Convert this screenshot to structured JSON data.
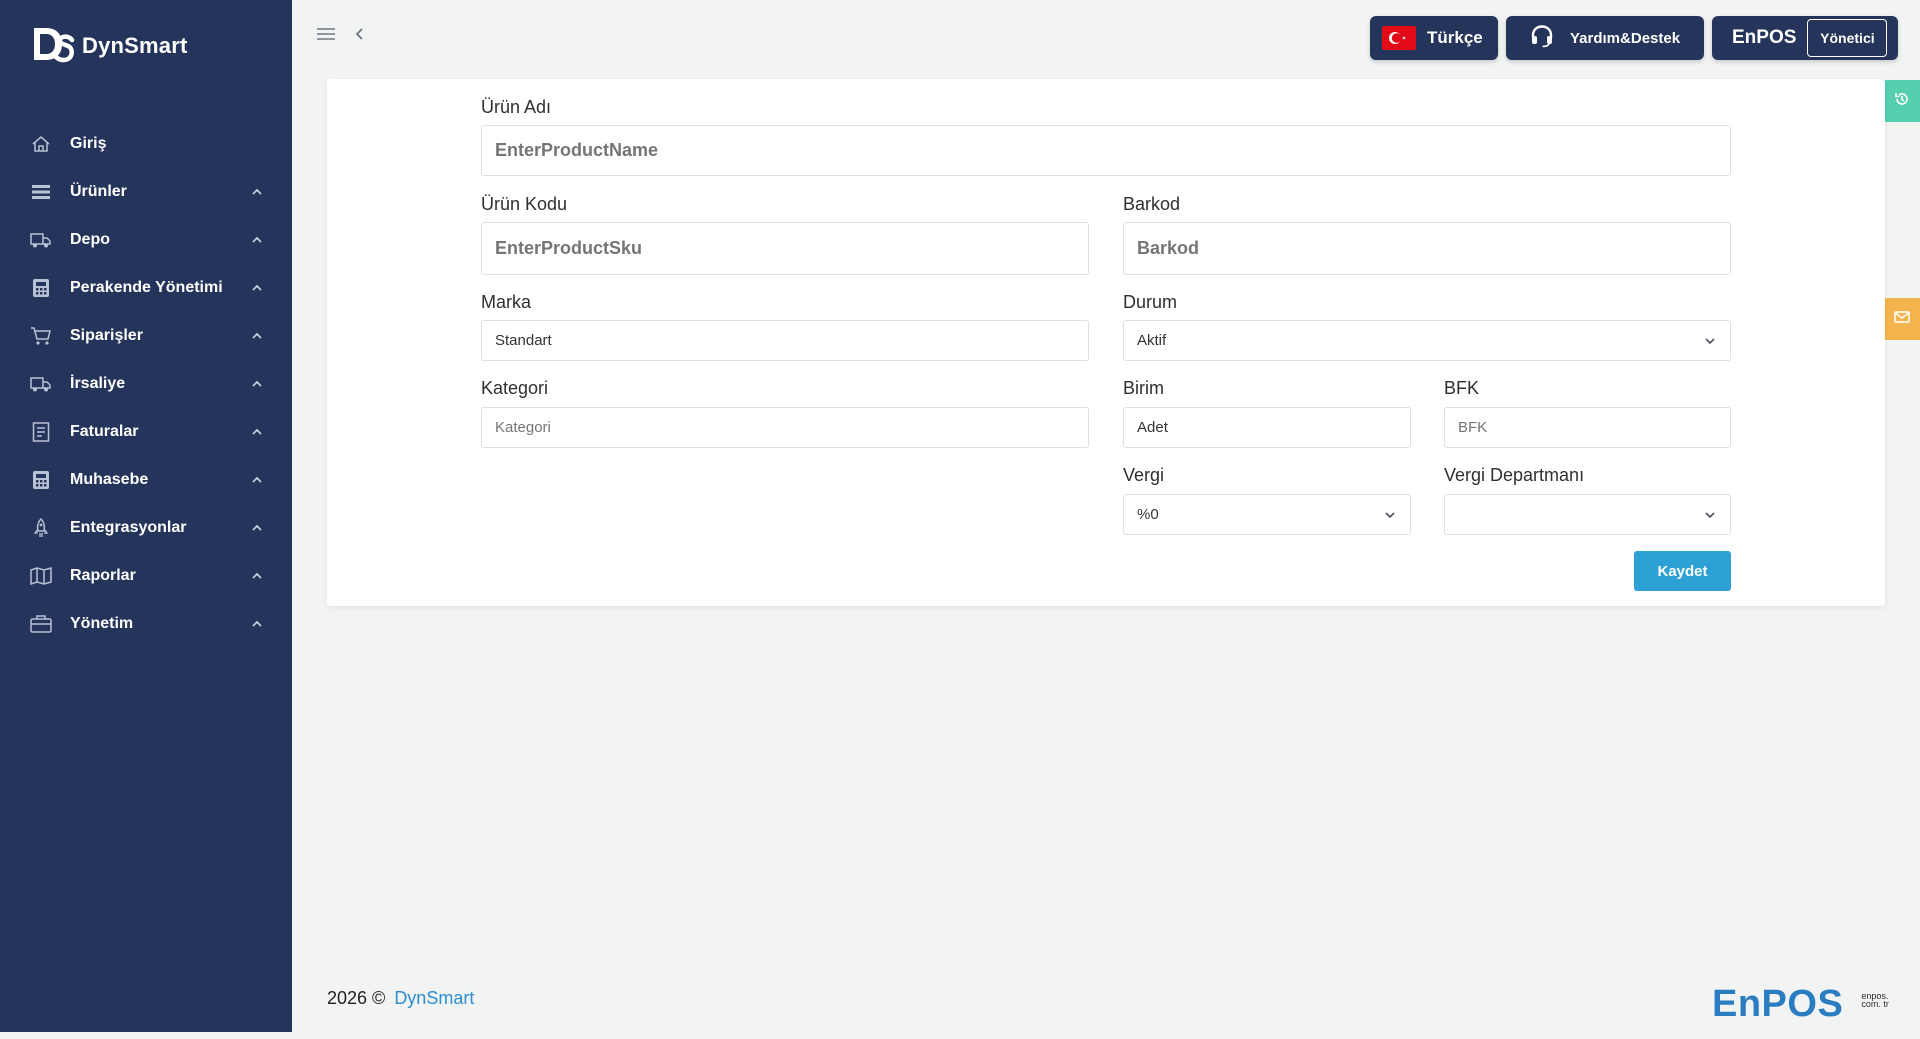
{
  "app": {
    "name": "DynSmart"
  },
  "sidebar": {
    "items": [
      {
        "label": "Giriş",
        "icon": "home-icon",
        "expandable": false
      },
      {
        "label": "Ürünler",
        "icon": "list-icon",
        "expandable": true
      },
      {
        "label": "Depo",
        "icon": "truck-icon",
        "expandable": true
      },
      {
        "label": "Perakende Yönetimi",
        "icon": "calculator-icon",
        "expandable": true
      },
      {
        "label": "Siparişler",
        "icon": "cart-icon",
        "expandable": true
      },
      {
        "label": "İrsaliye",
        "icon": "truck-icon",
        "expandable": true
      },
      {
        "label": "Faturalar",
        "icon": "invoice-icon",
        "expandable": true
      },
      {
        "label": "Muhasebe",
        "icon": "calculator-icon",
        "expandable": true
      },
      {
        "label": "Entegrasyonlar",
        "icon": "rocket-icon",
        "expandable": true
      },
      {
        "label": "Raporlar",
        "icon": "map-icon",
        "expandable": true
      },
      {
        "label": "Yönetim",
        "icon": "briefcase-icon",
        "expandable": true
      }
    ]
  },
  "header": {
    "language": "Türkçe",
    "help": "Yardım&Destek",
    "brand": "EnPOS",
    "role": "Yönetici"
  },
  "form": {
    "product_name": {
      "label": "Ürün Adı",
      "placeholder": "EnterProductName",
      "value": ""
    },
    "product_code": {
      "label": "Ürün Kodu",
      "placeholder": "EnterProductSku",
      "value": ""
    },
    "barcode": {
      "label": "Barkod",
      "placeholder": "Barkod",
      "value": ""
    },
    "brand": {
      "label": "Marka",
      "value": "Standart"
    },
    "status": {
      "label": "Durum",
      "value": "Aktif"
    },
    "category": {
      "label": "Kategori",
      "placeholder": "Kategori",
      "value": ""
    },
    "unit": {
      "label": "Birim",
      "value": "Adet"
    },
    "bfk": {
      "label": "BFK",
      "placeholder": "BFK",
      "value": ""
    },
    "tax": {
      "label": "Vergi",
      "value": "%0"
    },
    "tax_department": {
      "label": "Vergi Departmanı",
      "value": ""
    },
    "save_label": "Kaydet"
  },
  "footer": {
    "year": "2026 ©",
    "link": "DynSmart",
    "brand": "EnPOS",
    "domain": "enpos. com. tr"
  },
  "colors": {
    "sidebar": "#25345a",
    "accent": "#2da0d5",
    "green_tab": "#56cfaf",
    "orange_tab": "#f3b44d"
  }
}
